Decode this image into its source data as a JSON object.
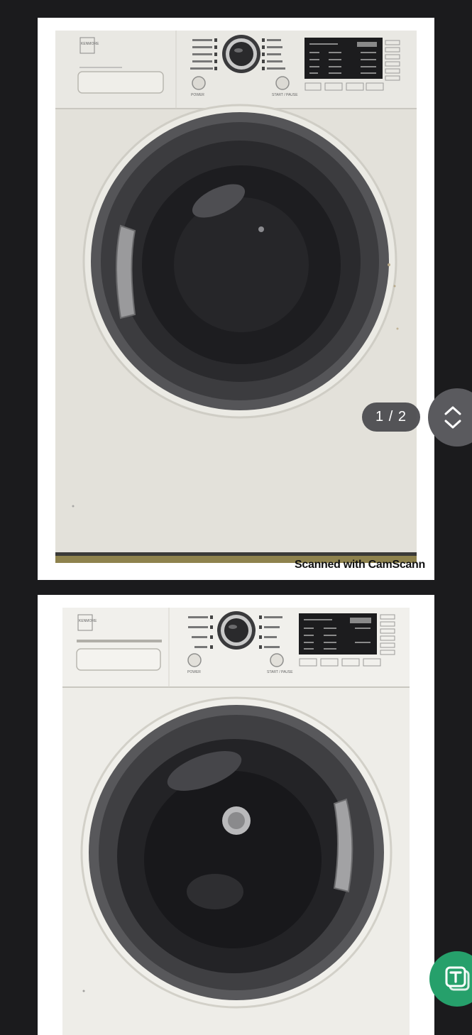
{
  "viewer": {
    "page_indicator": "1 / 2",
    "scan_watermark": "Scanned with CamScann"
  },
  "photo1": {
    "brand": "KENMORE",
    "buttons": {
      "power": "POWER",
      "start_pause": "START / PAUSE"
    }
  },
  "photo2": {
    "brand": "KENMORE",
    "buttons": {
      "power": "POWER",
      "start_pause": "START / PAUSE"
    }
  },
  "icons": {
    "nav": "expand-collapse-chevrons-icon",
    "fab": "translate-t-icon"
  },
  "colors": {
    "background": "#1b1b1d",
    "indicator_bg": "#48484c",
    "fab_green": "#26a06b"
  }
}
